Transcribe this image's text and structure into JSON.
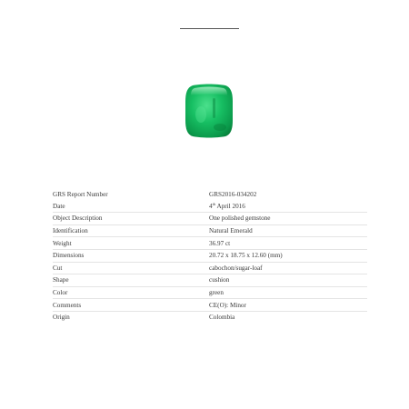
{
  "report": {
    "number_label": "GRS Report Number",
    "number_value": "GRS2016-034202",
    "date_label": "Date",
    "date_day": "4",
    "date_suffix": "th",
    "date_rest": " April 2016",
    "object_label": "Object Description",
    "object_value": "One polished gemstone",
    "identification_label": "Identification",
    "identification_value": "Natural Emerald",
    "weight_label": "Weight",
    "weight_value": "36.97 ct",
    "dimensions_label": "Dimensions",
    "dimensions_value": "20.72 x 18.75 x 12.60 (mm)",
    "cut_label": "Cut",
    "cut_value": "cabochon/sugar-loaf",
    "shape_label": "Shape",
    "shape_value": "cushion",
    "color_label": "Color",
    "color_value": "green",
    "comments_label": "Comments",
    "comments_value": "CE(O): Minor",
    "origin_label": "Origin",
    "origin_value": "Colombia"
  },
  "colors": {
    "gem_light": "#35d67a",
    "gem_mid": "#10b25a",
    "gem_dark": "#0a8f45"
  }
}
